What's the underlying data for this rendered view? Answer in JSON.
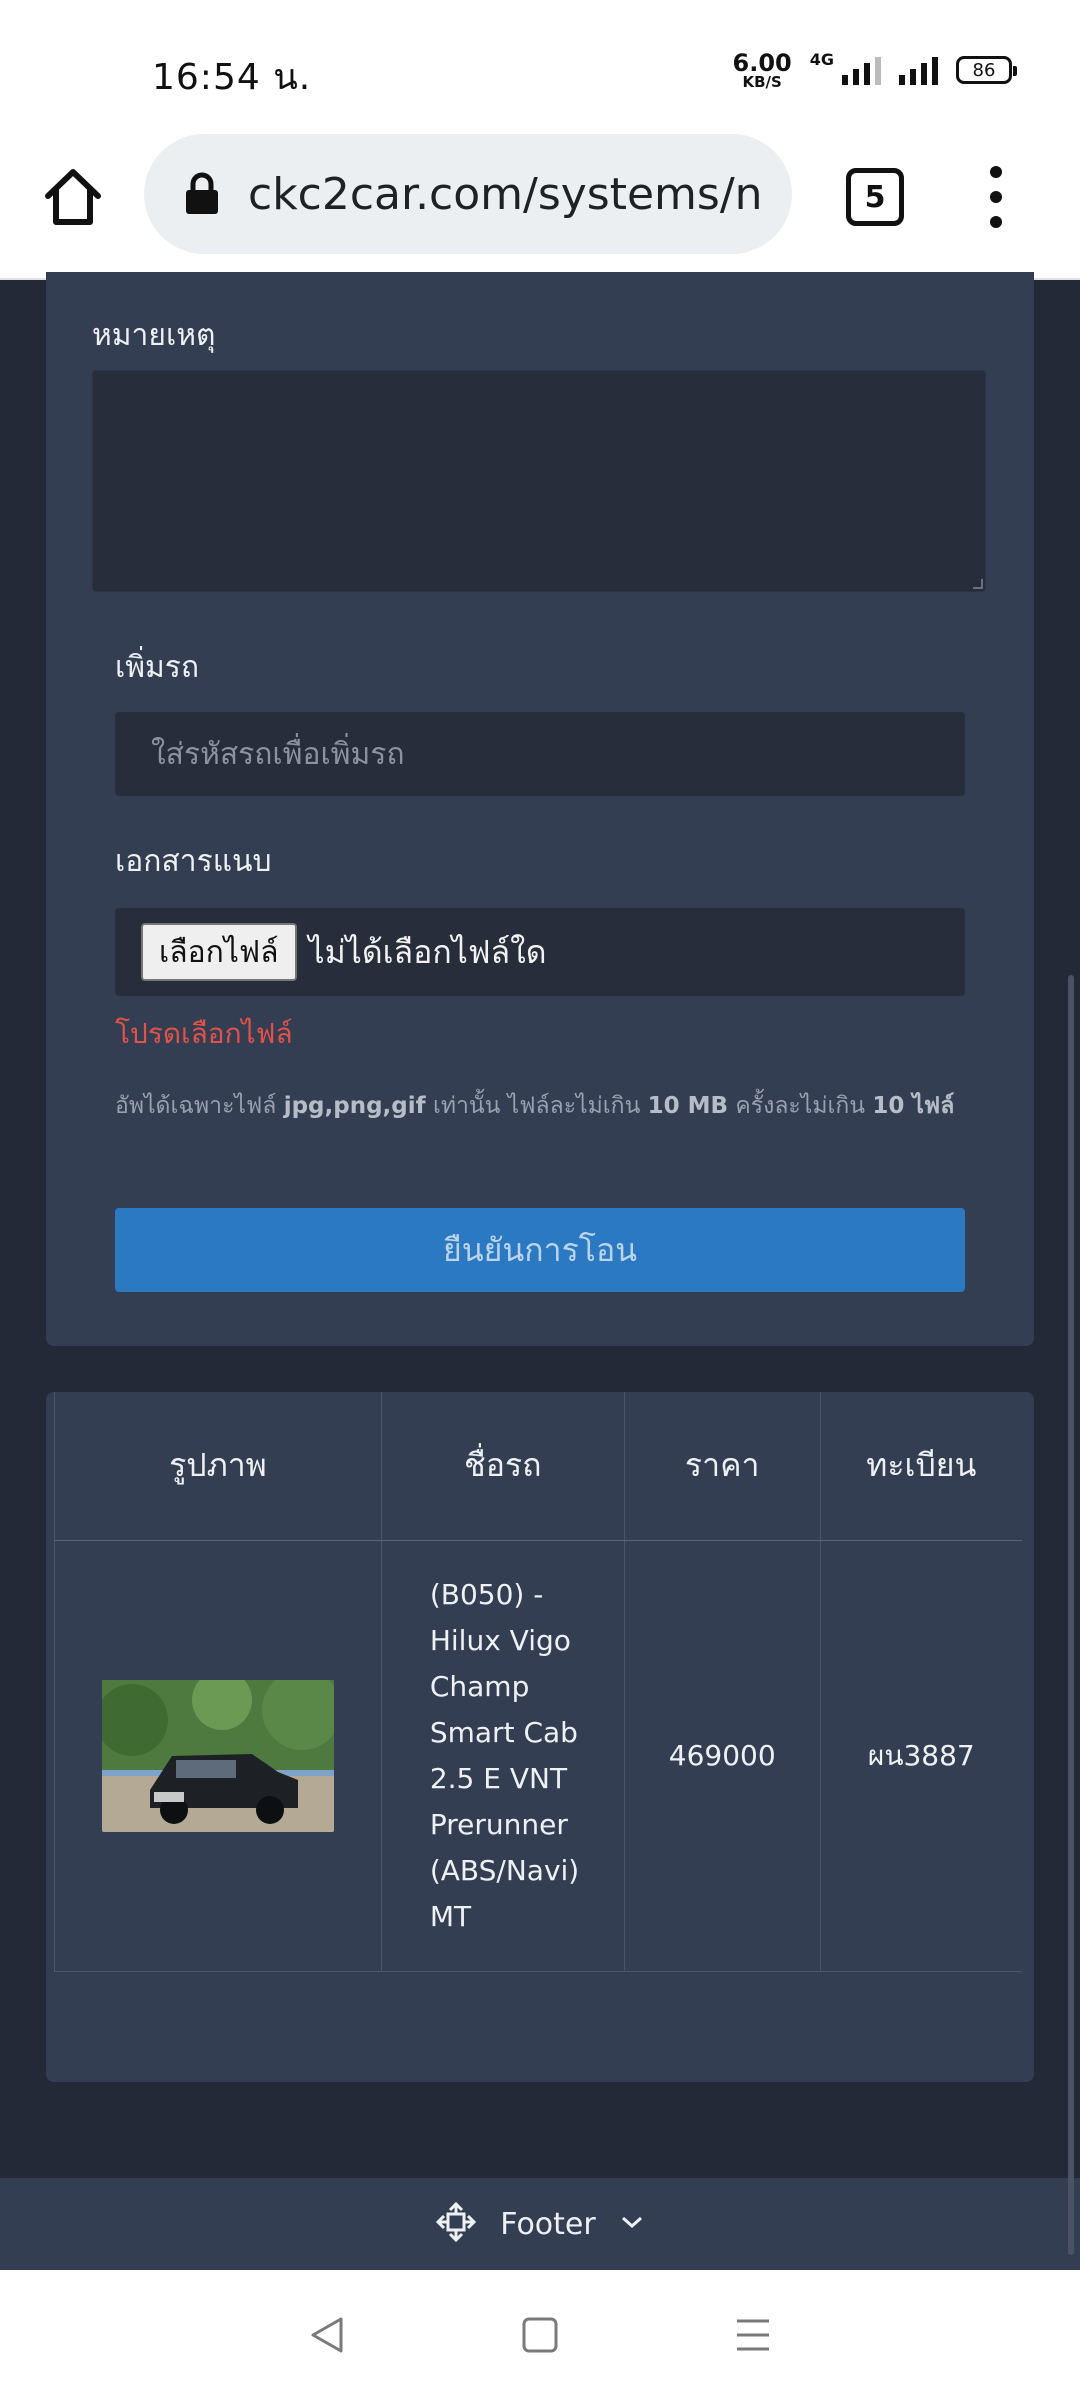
{
  "status": {
    "time": "16:54 น.",
    "net_speed_value": "6.00",
    "net_speed_unit": "KB/S",
    "network_type": "4G",
    "battery": "86"
  },
  "browser": {
    "url": "ckc2car.com/systems/n",
    "tab_count": "5"
  },
  "form": {
    "note_label": "หมายเหตุ",
    "note_value": "",
    "add_car_label": "เพิ่มรถ",
    "add_car_placeholder": "ใส่รหัสรถเพื่อเพิ่มรถ",
    "attachment_label": "เอกสารแนบ",
    "choose_file_button": "เลือกไฟล์",
    "no_file_text": "ไม่ได้เลือกไฟล์ใด",
    "error_text": "โปรดเลือกไฟล์",
    "hint": {
      "part1": "อัพได้เฉพาะไฟล์ ",
      "types": "jpg,png,gif",
      "part2": " เท่านั้น ไฟล์ละไม่เกิน ",
      "size": "10 MB",
      "part3": " ครั้งละไม่เกิน ",
      "count": "10 ไฟล์"
    },
    "submit_button": "ยืนยันการโอน"
  },
  "table": {
    "headers": [
      "รูปภาพ",
      "ชื่อรถ",
      "ราคา",
      "ทะเบียน"
    ],
    "rows": [
      {
        "name_lines": [
          "(B050) -",
          "Hilux Vigo",
          "Champ",
          "Smart Cab",
          "2.5 E VNT",
          "Prerunner",
          "(ABS/Navi)",
          "MT"
        ],
        "price": "469000",
        "plate": "ผน3887"
      }
    ]
  },
  "footer": {
    "label": "Footer"
  },
  "colors": {
    "page_bg": "#232936",
    "card_bg": "#343e52",
    "input_bg": "#272d3a",
    "accent_button": "#2a79c2",
    "error": "#e0524a"
  },
  "icons": [
    "home-icon",
    "lock-icon",
    "tabs-icon",
    "more-vert-icon",
    "footer-nav-icon",
    "chevron-down-icon",
    "back-nav-icon",
    "home-nav-icon",
    "recents-nav-icon"
  ]
}
